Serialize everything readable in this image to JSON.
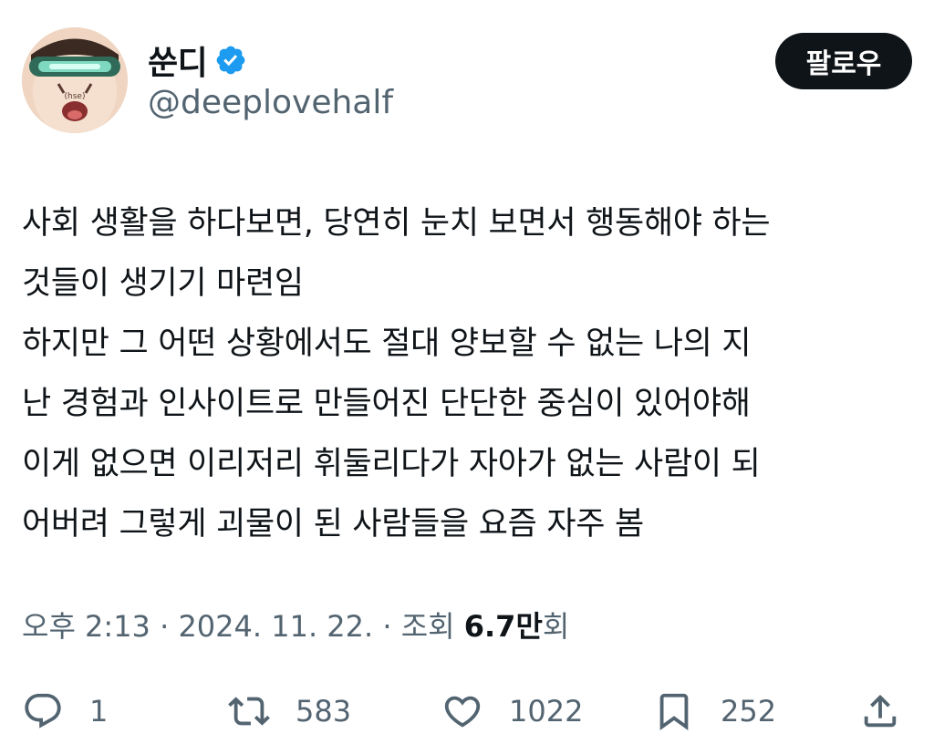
{
  "author": {
    "display_name": "쑨디",
    "handle": "@deeplovehalf",
    "verified_icon": "verified-badge-icon",
    "verified_color": "#1d9bf0"
  },
  "follow_button": {
    "label": "팔로우"
  },
  "tweet": {
    "lines": [
      "사회 생활을 하다보면, 당연히 눈치 보면서 행동해야 하는",
      "것들이 생기기 마련임",
      "하지만 그 어떤 상황에서도 절대 양보할 수 없는 나의 지",
      "난 경험과 인사이트로 만들어진 단단한 중심이 있어야해",
      "이게 없으면 이리저리 휘둘리다가 자아가 없는 사람이 되",
      "어버려 그렇게 괴물이 된 사람들을 요즘 자주 봄"
    ]
  },
  "meta": {
    "time": "오후 2:13",
    "separator": " · ",
    "date": "2024. 11. 22.",
    "views_label": "조회",
    "views_count": "6.7만",
    "views_suffix": "회"
  },
  "actions": {
    "reply": {
      "icon": "reply-icon",
      "count": "1"
    },
    "retweet": {
      "icon": "retweet-icon",
      "count": "583"
    },
    "like": {
      "icon": "heart-icon",
      "count": "1022"
    },
    "bookmark": {
      "icon": "bookmark-icon",
      "count": "252"
    },
    "share": {
      "icon": "share-icon"
    }
  },
  "colors": {
    "text": "#0f1419",
    "secondary": "#536471",
    "button_bg": "#0f1419",
    "button_text": "#ffffff"
  }
}
